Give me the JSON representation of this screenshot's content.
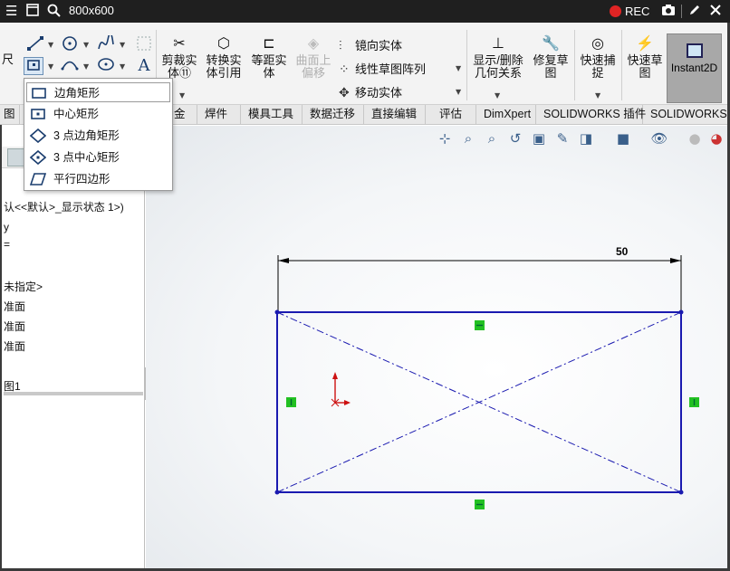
{
  "recorder": {
    "title": "800x600",
    "rec_label": "REC",
    "rec_color": "#e02424"
  },
  "ribbon": {
    "sketch_left_label": "尺",
    "trim": "剪裁实\n体⑪",
    "convert": "转换实\n体引用",
    "offset": "等距实\n体",
    "surface_offset": "曲面上\n偏移",
    "mirror": "镜向实体",
    "linear_pattern": "线性草图阵列",
    "move": "移动实体",
    "show_relations": "显示/删除\n几何关系",
    "repair": "修复草\n图",
    "quick_snap": "快速捕\n捉",
    "rapid_sketch": "快速草\n图",
    "instant2d": "Instant2D"
  },
  "tabs": [
    {
      "label": "图"
    },
    {
      "label": "金"
    },
    {
      "label": "焊件"
    },
    {
      "label": "模具工具"
    },
    {
      "label": "数据迁移"
    },
    {
      "label": "直接编辑"
    },
    {
      "label": "评估"
    },
    {
      "label": "DimXpert"
    },
    {
      "label": "SOLIDWORKS 插件"
    },
    {
      "label": "SOLIDWORKS M"
    }
  ],
  "menu": {
    "items": [
      {
        "label": "边角矩形"
      },
      {
        "label": "中心矩形"
      },
      {
        "label": "3 点边角矩形"
      },
      {
        "label": "3 点中心矩形"
      },
      {
        "label": "平行四边形"
      }
    ]
  },
  "tree": {
    "display_state": "认<<默认>_显示状态 1>)",
    "sensors": "y",
    "annotations": "=",
    "material": "未指定>",
    "plane1": "准面",
    "plane2": "准面",
    "plane3": "准面",
    "sketch": "图1"
  },
  "sketch": {
    "dimension": "50",
    "line_color": "#1a1ab0",
    "relation_color": "#22c022",
    "origin_color": "#cc1111"
  }
}
